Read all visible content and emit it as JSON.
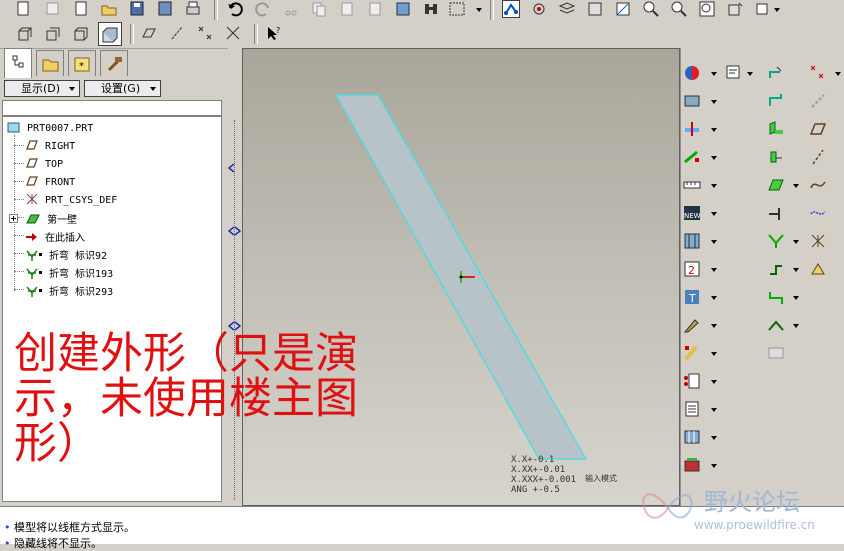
{
  "toolbar": {
    "display_menu": "显示(D)",
    "settings_menu": "设置(G)"
  },
  "tree": {
    "root": "PRT0007.PRT",
    "items": [
      {
        "label": "RIGHT",
        "icon": "datum-plane-icon"
      },
      {
        "label": "TOP",
        "icon": "datum-plane-icon"
      },
      {
        "label": "FRONT",
        "icon": "datum-plane-icon"
      },
      {
        "label": "PRT_CSYS_DEF",
        "icon": "csys-icon"
      },
      {
        "label": "第一壁",
        "icon": "sheetmetal-wall-icon"
      },
      {
        "label": "在此插入",
        "icon": "insert-arrow-icon"
      },
      {
        "label": "折弯 标识92",
        "icon": "bend-icon"
      },
      {
        "label": "折弯 标识193",
        "icon": "bend-icon"
      },
      {
        "label": "折弯 标识293",
        "icon": "bend-icon"
      }
    ]
  },
  "annotation": "创建外形（只是演示，未使用楼主图形）",
  "tolerance": {
    "line1": "X.X+-0.1",
    "line2": "X.XX+-0.01",
    "line3": "X.XXX+-0.001",
    "line4": "ANG +-0.5",
    "note": "输入模式"
  },
  "messages": [
    "模型将以线框方式显示。",
    "隐藏线将不显示。"
  ],
  "watermark": {
    "title": "野火论坛",
    "url": "www.proewildfire.cn"
  },
  "colors": {
    "shape_fill": "#b7c2c9",
    "shape_edge": "#3fe0e0",
    "annotation": "#e01010"
  }
}
